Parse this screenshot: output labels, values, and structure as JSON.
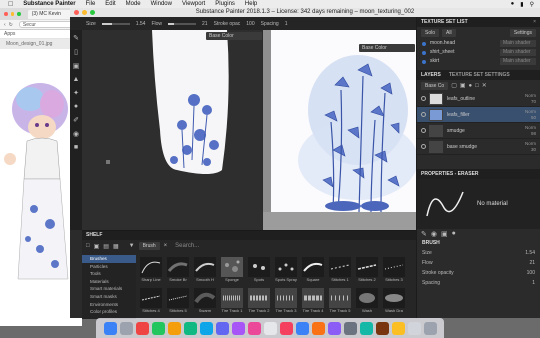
{
  "menubar": {
    "app": "Substance Painter",
    "items": [
      "File",
      "Edit",
      "Mode",
      "Window",
      "Viewport",
      "Plugins",
      "Help"
    ]
  },
  "browser": {
    "tab_title": "(3) MC Kevin",
    "url": "Secur",
    "bookmark": "Apps",
    "file_label": "Moon_design_01.jpg"
  },
  "window": {
    "title": "Substance Painter 2018.1.3 – License: 342 days remaining – moon_texturing_002"
  },
  "toolprops": {
    "size_label": "Size",
    "size_value": "1.54",
    "size_fill": 0.35,
    "flow_label": "Flow",
    "flow_value": "21",
    "flow_fill": 0.21,
    "stroke_label": "Stroke opac",
    "stroke_value": "100",
    "spacing_label": "Spacing",
    "spacing_value": "1"
  },
  "viewports": {
    "left_select": "Base Color",
    "right_select": "Base Color"
  },
  "texture_set_list": {
    "title": "TEXTURE SET LIST",
    "solo_btn": "Solo",
    "all_btn": "All",
    "settings_btn": "Settings",
    "sets": [
      {
        "name": "moon.head",
        "shader": "Main shader"
      },
      {
        "name": "shirt_sheet",
        "shader": "Main shader"
      },
      {
        "name": "skirt",
        "shader": "Main shader"
      }
    ]
  },
  "layers": {
    "tab_layers": "LAYERS",
    "tab_settings": "TEXTURE SET SETTINGS",
    "channel_select": "Base Co",
    "items": [
      {
        "name": "leafs_outline",
        "blend": "Norm",
        "opacity": "70"
      },
      {
        "name": "leafs_filler",
        "blend": "Norm",
        "opacity": "50"
      },
      {
        "name": "smudge",
        "blend": "Norm",
        "opacity": "98"
      },
      {
        "name": "base smudge",
        "blend": "Norm",
        "opacity": "30"
      }
    ]
  },
  "properties": {
    "title": "PROPERTIES - ERASER",
    "material": "No material",
    "brush_header": "BRUSH",
    "size_label": "Size",
    "size_value": "1.54",
    "flow_label": "Flow",
    "flow_value": "21",
    "stroke_label": "Stroke opacity",
    "stroke_value": "100",
    "spacing_label": "Spacing",
    "spacing_value": "1"
  },
  "shelf": {
    "title": "SHELF",
    "filter_chip": "Brush",
    "search_placeholder": "Search...",
    "categories": [
      "Brushes",
      "Particles",
      "Tools",
      "Materials",
      "Smart materials",
      "Smart masks",
      "Environments",
      "Color profiles"
    ],
    "brushes_row1": [
      "Sharp Line",
      "Smoke Br",
      "Smooth H",
      "Sponge",
      "Spots",
      "Spots Spray",
      "Square",
      "Stitches 1",
      "Stitches 2",
      "Stitches 3"
    ],
    "brushes_row2": [
      "Stitches 4",
      "Stitches 5",
      "Swarm",
      "Tire Track 1",
      "Tire Track 2",
      "Tire Track 3",
      "Tire Track 4",
      "Tire Track 5",
      "Wash",
      "Wash Dra"
    ]
  },
  "dock": {
    "icon_colors": [
      "#3b82f6",
      "#9ca3af",
      "#ef4444",
      "#22c55e",
      "#f59e0b",
      "#10b981",
      "#0ea5e9",
      "#6366f1",
      "#a855f7",
      "#ec4899",
      "#e5e7eb",
      "#f43f5e",
      "#3b82f6",
      "#f97316",
      "#8b5cf6",
      "#6b7280",
      "#14b8a6",
      "#78350f",
      "#fbbf24",
      "#d1d5db",
      "#9ca3af"
    ]
  }
}
